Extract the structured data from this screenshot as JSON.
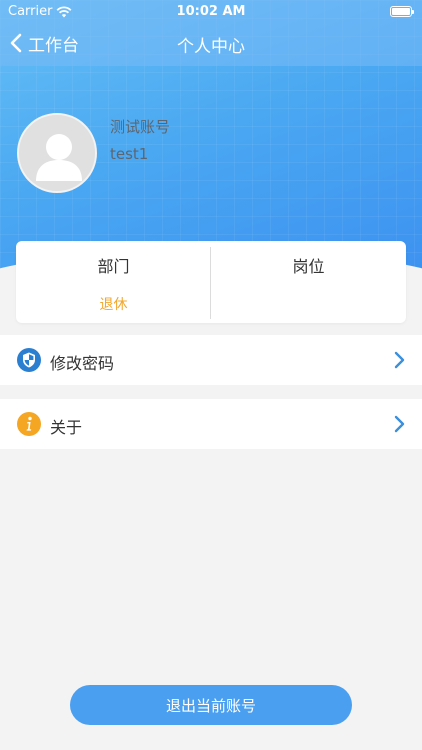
{
  "status_bar": {
    "carrier": "Carrier",
    "time": "10:02 AM"
  },
  "nav": {
    "back_label": "工作台",
    "title": "个人中心"
  },
  "profile": {
    "name": "测试账号",
    "account": "test1"
  },
  "info_card": {
    "department_label": "部门",
    "department_value": "退休",
    "position_label": "岗位",
    "position_value": ""
  },
  "menu": {
    "items": [
      {
        "label": "修改密码",
        "icon": "shield-icon"
      },
      {
        "label": "关于",
        "icon": "info-icon"
      }
    ]
  },
  "logout": {
    "label": "退出当前账号"
  },
  "colors": {
    "accent": "#4a9ff0",
    "department_value": "#f0a830",
    "info_icon": "#f5a623",
    "shield_icon": "#2b7fd0"
  }
}
